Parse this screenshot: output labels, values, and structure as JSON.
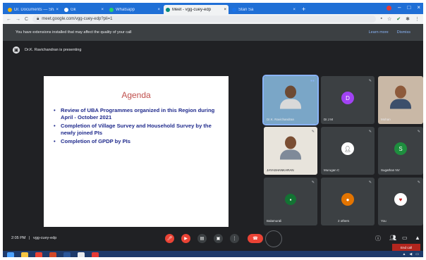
{
  "browser": {
    "tabs": [
      {
        "label": "Dr. Documents — Sha Kam",
        "active": false
      },
      {
        "label": "Gk",
        "active": false
      },
      {
        "label": "Whatsapp",
        "active": false
      },
      {
        "label": "Meet - vgg-cuey-edp",
        "active": true
      },
      {
        "label": "Stan Sa",
        "active": false
      }
    ],
    "new_tab": "+",
    "url": "meet.google.com/vgg-cuey-edp?pli=1",
    "back": "←",
    "forward": "→",
    "reload": "C"
  },
  "notice": {
    "text": "You have extensions installed that may affect the quality of your call",
    "learn_more": "Learn more",
    "dismiss": "Dismiss"
  },
  "presenting": {
    "text": "Dr.K. Ravichandran is presenting"
  },
  "slide": {
    "title": "Agenda",
    "bullets": [
      "Review of UBA Programmes organized in this Region during April - October 2021",
      "Completion of Village Survey and Household Survey by the newly joined PIs",
      "Completion of GPDP by PIs"
    ]
  },
  "participants": [
    {
      "name": "Dr.K. Ravichandran",
      "type": "video",
      "speaking": true
    },
    {
      "name": "Dr.J M",
      "type": "avatar",
      "initial": "D",
      "color": "#a142f4"
    },
    {
      "name": "Mohan",
      "type": "video"
    },
    {
      "name": "JAYASHANKARAN",
      "type": "video"
    },
    {
      "name": "Murugan C",
      "type": "avatar",
      "initial": "",
      "color": "#5f6368"
    },
    {
      "name": "Sugathan NV",
      "type": "avatar",
      "initial": "S",
      "color": "#1e8e3e"
    },
    {
      "name": "Balamurali",
      "type": "avatar",
      "initial": "",
      "color": "#3c4043"
    },
    {
      "name": "2 others",
      "type": "avatar",
      "initial": "",
      "color": "#e37400"
    },
    {
      "name": "You",
      "type": "avatar",
      "initial": "",
      "color": "#ffffff"
    }
  ],
  "bottom_bar": {
    "time": "2:05 PM",
    "meeting_code": "vgg-cuey-edp",
    "separator": "|",
    "tooltip": "End call"
  },
  "colors": {
    "accent": "#1a73e8",
    "danger": "#ea4335",
    "slide_title": "#c0504d",
    "slide_text": "#1f2a8c"
  }
}
